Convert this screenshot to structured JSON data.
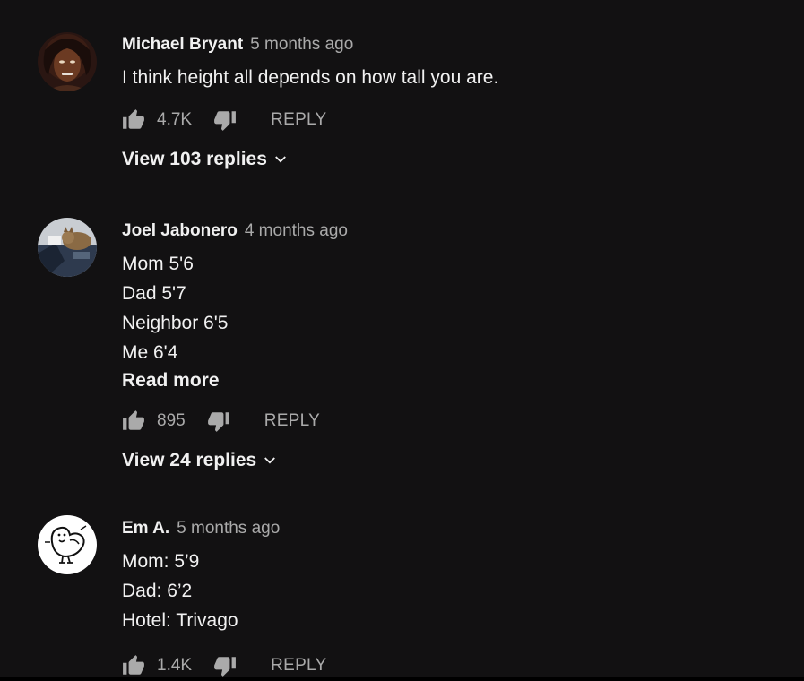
{
  "comments": [
    {
      "author": "Michael Bryant",
      "time": "5 months ago",
      "lines": [
        "I think height all depends on how tall you are."
      ],
      "likes": "4.7K",
      "reply_label": "REPLY",
      "view_replies": "View 103 replies",
      "avatar": "person-avatar-dark"
    },
    {
      "author": "Joel Jabonero",
      "time": "4 months ago",
      "lines": [
        "Mom 5'6",
        "Dad 5'7",
        "Neighbor 6'5",
        "Me 6'4"
      ],
      "read_more": "Read more",
      "likes": "895",
      "reply_label": "REPLY",
      "view_replies": "View 24 replies",
      "avatar": "cat-avatar"
    },
    {
      "author": "Em A.",
      "time": "5 months ago",
      "lines": [
        "Mom: 5’9",
        "Dad: 6’2",
        "Hotel: Trivago"
      ],
      "likes": "1.4K",
      "reply_label": "REPLY",
      "avatar": "bird-doodle-avatar"
    }
  ],
  "colors": {
    "background": "#121112",
    "text_primary": "#f1f1f1",
    "text_secondary": "#aaaaaa"
  }
}
